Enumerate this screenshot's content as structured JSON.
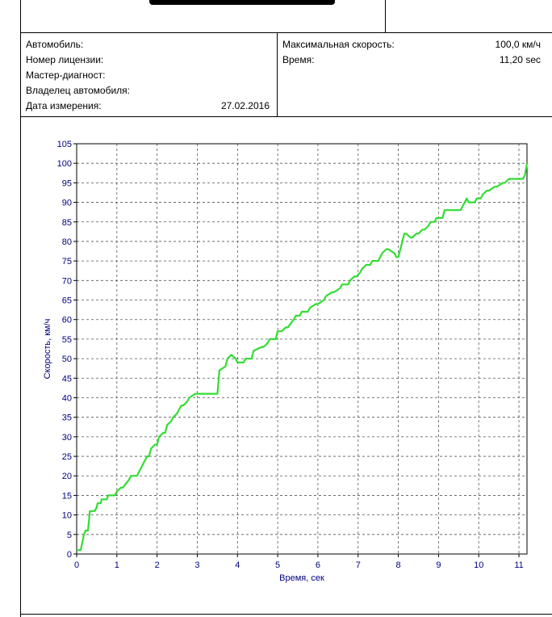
{
  "info": {
    "left_rows": [
      {
        "label": "Автомобиль:",
        "value": ""
      },
      {
        "label": "Номер  лицензии:",
        "value": ""
      },
      {
        "label": "Мастер-диагност:",
        "value": ""
      },
      {
        "label": "Владелец  автомобиля:",
        "value": ""
      },
      {
        "label": "Дата  измерения:",
        "value": "27.02.2016"
      }
    ],
    "right_rows": [
      {
        "label": "Максимальная  скорость:",
        "value": "100,0 км/ч"
      },
      {
        "label": "Время:",
        "value": "11,20 sec"
      }
    ]
  },
  "colors": {
    "series": "#33dd33",
    "axis_text": "#000080",
    "grid": "#555555"
  },
  "chart_data": {
    "type": "line",
    "xlabel": "Время, сек",
    "ylabel": "Скорость, км/ч",
    "xlim": [
      0,
      11.2
    ],
    "ylim": [
      0,
      105
    ],
    "xticks": [
      0,
      1,
      2,
      3,
      4,
      5,
      6,
      7,
      8,
      9,
      10,
      11
    ],
    "yticks": [
      0,
      5,
      10,
      15,
      20,
      25,
      30,
      35,
      40,
      45,
      50,
      55,
      60,
      65,
      70,
      75,
      80,
      85,
      90,
      95,
      100,
      105
    ],
    "grid": true,
    "series": [
      {
        "values_x": [
          0,
          0.1,
          0.18,
          0.22,
          0.28,
          0.33,
          0.45,
          0.5,
          0.52,
          0.6,
          0.62,
          0.75,
          0.78,
          0.95,
          1.0,
          1.1,
          1.15,
          1.3,
          1.35,
          1.5,
          1.55,
          1.6,
          1.65,
          1.7,
          1.75,
          1.8,
          1.85,
          1.95,
          2.0,
          2.05,
          2.15,
          2.2,
          2.25,
          2.35,
          2.4,
          2.5,
          2.55,
          2.6,
          2.65,
          2.75,
          2.8,
          2.95,
          3.0,
          3.5,
          3.55,
          3.7,
          3.75,
          3.85,
          3.95,
          4.0,
          4.15,
          4.2,
          4.35,
          4.4,
          4.6,
          4.65,
          4.75,
          4.8,
          4.95,
          5.0,
          5.1,
          5.2,
          5.25,
          5.4,
          5.45,
          5.55,
          5.6,
          5.75,
          5.8,
          5.95,
          6.0,
          6.15,
          6.2,
          6.35,
          6.4,
          6.55,
          6.6,
          6.75,
          6.8,
          6.9,
          6.95,
          7.05,
          7.1,
          7.2,
          7.3,
          7.35,
          7.5,
          7.6,
          7.7,
          7.75,
          7.9,
          7.95,
          8.0,
          8.15,
          8.2,
          8.3,
          8.35,
          8.45,
          8.5,
          8.6,
          8.65,
          8.75,
          8.8,
          8.9,
          8.95,
          9.1,
          9.15,
          9.5,
          9.55,
          9.7,
          9.75,
          9.9,
          9.95,
          10.05,
          10.1,
          10.2,
          10.25,
          10.4,
          10.45,
          10.6,
          10.65,
          10.75,
          10.8,
          11.1,
          11.15,
          11.2
        ],
        "values_y": [
          1,
          1,
          5,
          6,
          6,
          11,
          11,
          12,
          13,
          13,
          14,
          14,
          15,
          15,
          16,
          17,
          17,
          19,
          20,
          20,
          21,
          22,
          23,
          24,
          25,
          25,
          27,
          28,
          28,
          30,
          31,
          31,
          33,
          34,
          35,
          36,
          37,
          38,
          38,
          39,
          40,
          41,
          41,
          41,
          47,
          48,
          50,
          51,
          50,
          49,
          49,
          50,
          50,
          52,
          53,
          53,
          54,
          55,
          55,
          57,
          57,
          58,
          58,
          60,
          61,
          61,
          62,
          62,
          63,
          64,
          64,
          65,
          66,
          67,
          67,
          68,
          69,
          69,
          70,
          71,
          71,
          72,
          73,
          74,
          74,
          75,
          75,
          77,
          78,
          78,
          77,
          76,
          76,
          82,
          82,
          81,
          81,
          82,
          82,
          83,
          83,
          84,
          85,
          85,
          86,
          86,
          88,
          88,
          88,
          91,
          90,
          90,
          91,
          91,
          92,
          93,
          93,
          94,
          94,
          95,
          95,
          96,
          96,
          96,
          97,
          100
        ]
      }
    ]
  }
}
